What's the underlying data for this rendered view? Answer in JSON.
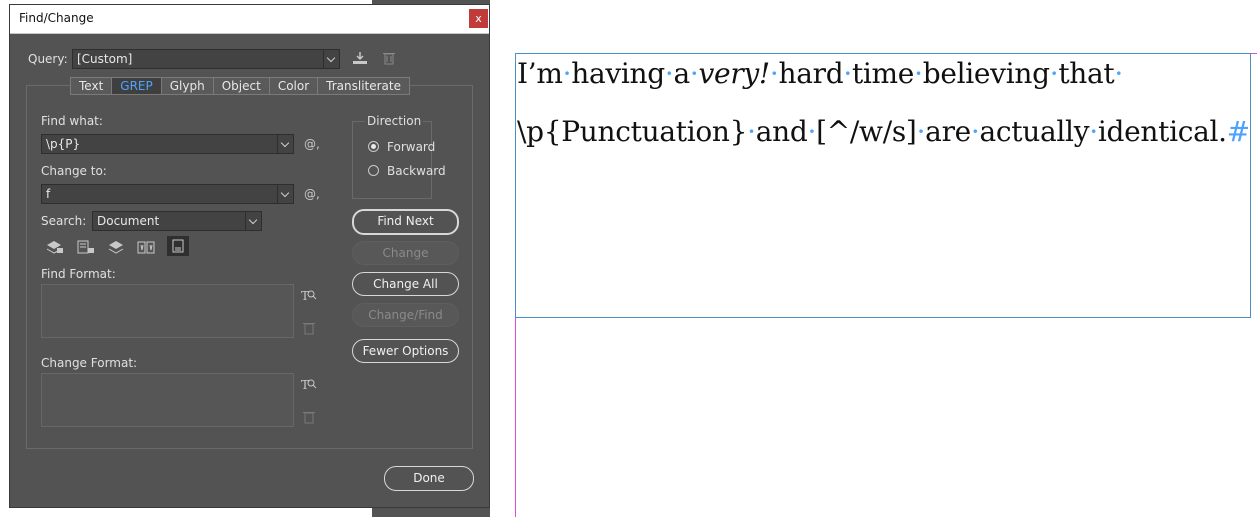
{
  "window": {
    "title": "Find/Change",
    "close_glyph": "x"
  },
  "query": {
    "label": "Query:",
    "value": "[Custom]",
    "save_icon": "save-query-icon",
    "delete_icon": "delete-query-icon"
  },
  "tabs": [
    {
      "label": "Text",
      "active": false
    },
    {
      "label": "GREP",
      "active": true
    },
    {
      "label": "Glyph",
      "active": false
    },
    {
      "label": "Object",
      "active": false
    },
    {
      "label": "Color",
      "active": false
    },
    {
      "label": "Transliterate",
      "active": false
    }
  ],
  "find_what": {
    "label": "Find what:",
    "value": "\\p{P}",
    "special_chars_glyph": "@,"
  },
  "change_to": {
    "label": "Change to:",
    "value": "f",
    "special_chars_glyph": "@,"
  },
  "search": {
    "label": "Search:",
    "value": "Document"
  },
  "direction": {
    "label": "Direction",
    "forward": "Forward",
    "backward": "Backward",
    "selected": "Forward"
  },
  "buttons": {
    "find_next": "Find Next",
    "change": "Change",
    "change_all": "Change All",
    "change_find": "Change/Find",
    "fewer_options": "Fewer Options",
    "done": "Done"
  },
  "find_format": {
    "label": "Find Format:"
  },
  "change_format": {
    "label": "Change Format:"
  },
  "document": {
    "line1": {
      "w1": "I’m",
      "w2": "having",
      "w3": "a",
      "w4": "very!",
      "w5": "hard",
      "w6": "time",
      "w7": "believing",
      "w8": "that"
    },
    "line2": {
      "w1": "\\p{Punctuation}",
      "w2": "and",
      "w3": "[^/w/s]",
      "w4": "are",
      "w5": "actually",
      "w6": "identical."
    },
    "space_marker": "·",
    "end_marker": "#"
  },
  "colors": {
    "dialog_bg": "#535353",
    "active_tab": "#4fa3ff",
    "invisibles": "#4fa3ff",
    "frame": "#4a90c8",
    "margin": "#d64dd6"
  }
}
